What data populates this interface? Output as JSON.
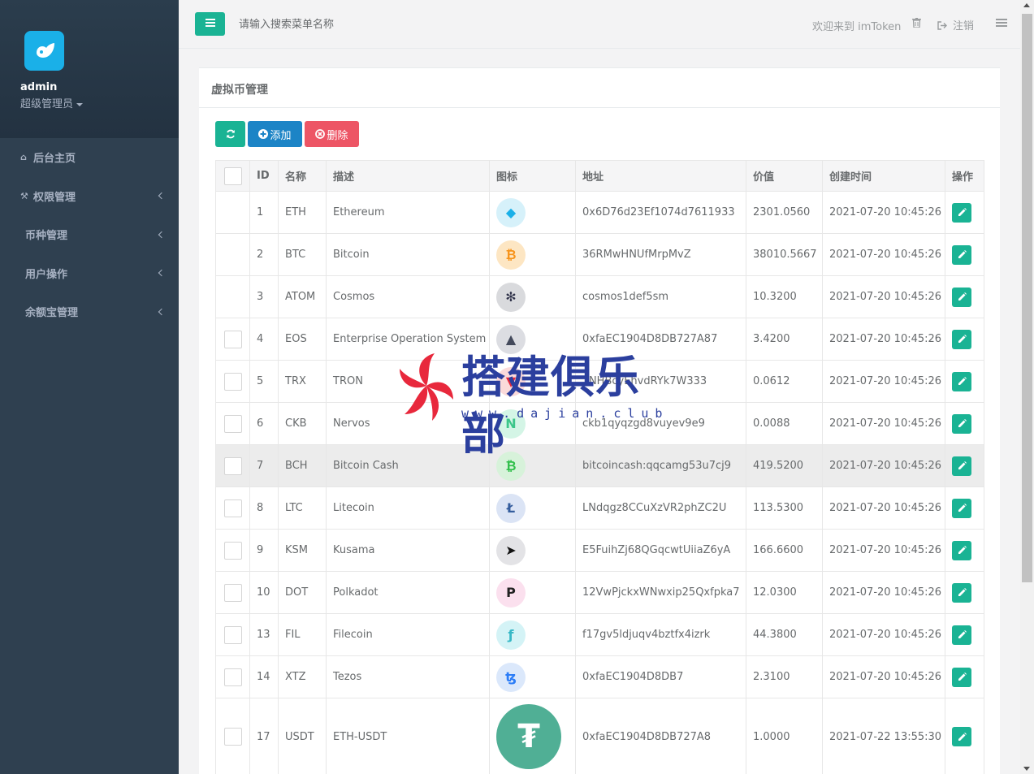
{
  "sidebar": {
    "user": "admin",
    "role": "超级管理员",
    "items": [
      {
        "label": "后台主页",
        "icon": "home-icon",
        "arrow": false
      },
      {
        "label": "权限管理",
        "icon": "wrench-icon",
        "arrow": true
      },
      {
        "label": "币种管理",
        "icon": "",
        "arrow": true
      },
      {
        "label": "用户操作",
        "icon": "",
        "arrow": true
      },
      {
        "label": "余额宝管理",
        "icon": "",
        "arrow": true
      }
    ]
  },
  "topbar": {
    "search_placeholder": "请输入搜索菜单名称",
    "welcome": "欢迎来到 imToken",
    "logout": "注销"
  },
  "panel": {
    "title": "虚拟币管理",
    "add_label": "添加",
    "delete_label": "删除"
  },
  "table": {
    "headers": [
      "ID",
      "名称",
      "描述",
      "图标",
      "地址",
      "价值",
      "创建时间",
      "操作"
    ],
    "rows": [
      {
        "id": "1",
        "name": "ETH",
        "desc": "Ethereum",
        "addr": "0x6D76d23Ef1074d7611933",
        "value": "2301.0560",
        "time": "2021-07-20 10:45:26",
        "icon_bg": "#d6f1fa",
        "icon_color": "#1ab0e8",
        "glyph": "◆",
        "checkbox": false
      },
      {
        "id": "2",
        "name": "BTC",
        "desc": "Bitcoin",
        "addr": "36RMwHNUfMrpMvZ",
        "value": "38010.5667",
        "time": "2021-07-20 10:45:26",
        "icon_bg": "#fde6c3",
        "icon_color": "#f7931a",
        "glyph": "₿",
        "checkbox": false
      },
      {
        "id": "3",
        "name": "ATOM",
        "desc": "Cosmos",
        "addr": "cosmos1def5sm",
        "value": "10.3200",
        "time": "2021-07-20 10:45:26",
        "icon_bg": "#d9dadd",
        "icon_color": "#2e3148",
        "glyph": "✻",
        "checkbox": false
      },
      {
        "id": "4",
        "name": "EOS",
        "desc": "Enterprise Operation System",
        "addr": "0xfaEC1904D8DB727A87",
        "value": "3.4200",
        "time": "2021-07-20 10:45:26",
        "icon_bg": "#dcdde2",
        "icon_color": "#444a5c",
        "glyph": "▲",
        "checkbox": true
      },
      {
        "id": "5",
        "name": "TRX",
        "desc": "TRON",
        "addr": "TNHBcyEhvdRYk7W333",
        "value": "0.0612",
        "time": "2021-07-20 10:45:26",
        "icon_bg": "#fbdada",
        "icon_color": "#e8283c",
        "glyph": "▼",
        "checkbox": true
      },
      {
        "id": "6",
        "name": "CKB",
        "desc": "Nervos",
        "addr": "ckb1qyqzgd8vuyev9e9",
        "value": "0.0088",
        "time": "2021-07-20 10:45:26",
        "icon_bg": "#d4f5e6",
        "icon_color": "#3cc68a",
        "glyph": "N",
        "checkbox": true
      },
      {
        "id": "7",
        "name": "BCH",
        "desc": "Bitcoin Cash",
        "addr": "bitcoincash:qqcamg53u7cj9",
        "value": "419.5200",
        "time": "2021-07-20 10:45:26",
        "icon_bg": "#d7f2da",
        "icon_color": "#2fbf4a",
        "glyph": "₿",
        "checkbox": true
      },
      {
        "id": "8",
        "name": "LTC",
        "desc": "Litecoin",
        "addr": "LNdqgz8CCuXzVR2phZC2U",
        "value": "113.5300",
        "time": "2021-07-20 10:45:26",
        "icon_bg": "#dbe4f5",
        "icon_color": "#345d9d",
        "glyph": "Ł",
        "checkbox": true
      },
      {
        "id": "9",
        "name": "KSM",
        "desc": "Kusama",
        "addr": "E5FuihZj68QGqcwtUiiaZ6yA",
        "value": "166.6600",
        "time": "2021-07-20 10:45:26",
        "icon_bg": "#e3e3e6",
        "icon_color": "#111111",
        "glyph": "➤",
        "checkbox": true
      },
      {
        "id": "10",
        "name": "DOT",
        "desc": "Polkadot",
        "addr": "12VwPjckxWNwxip25Qxfpka7",
        "value": "12.0300",
        "time": "2021-07-20 10:45:26",
        "icon_bg": "#fbe0ee",
        "icon_color": "#222222",
        "glyph": "P",
        "checkbox": true
      },
      {
        "id": "13",
        "name": "FIL",
        "desc": "Filecoin",
        "addr": "f17gv5ldjuqv4bztfx4izrk",
        "value": "44.3800",
        "time": "2021-07-20 10:45:26",
        "icon_bg": "#d4f3f6",
        "icon_color": "#36b8c6",
        "glyph": "ƒ",
        "checkbox": true
      },
      {
        "id": "14",
        "name": "XTZ",
        "desc": "Tezos",
        "addr": "0xfaEC1904D8DB7",
        "value": "2.3100",
        "time": "2021-07-20 10:45:26",
        "icon_bg": "#dbe8fb",
        "icon_color": "#2c7df7",
        "glyph": "ꜩ",
        "checkbox": true
      },
      {
        "id": "17",
        "name": "USDT",
        "desc": "ETH-USDT",
        "addr": "0xfaEC1904D8DB727A8",
        "value": "1.0000",
        "time": "2021-07-22 13:55:30",
        "icon_bg": "#50af95",
        "icon_color": "#ffffff",
        "glyph": "₮",
        "checkbox": true
      }
    ]
  },
  "watermark": {
    "title": "搭建俱乐部",
    "subtitle": "www.dajian.club"
  },
  "colors": {
    "sidebar": "#2f4050",
    "primary": "#1ab394",
    "info": "#1c84c6",
    "danger": "#ed5565"
  }
}
